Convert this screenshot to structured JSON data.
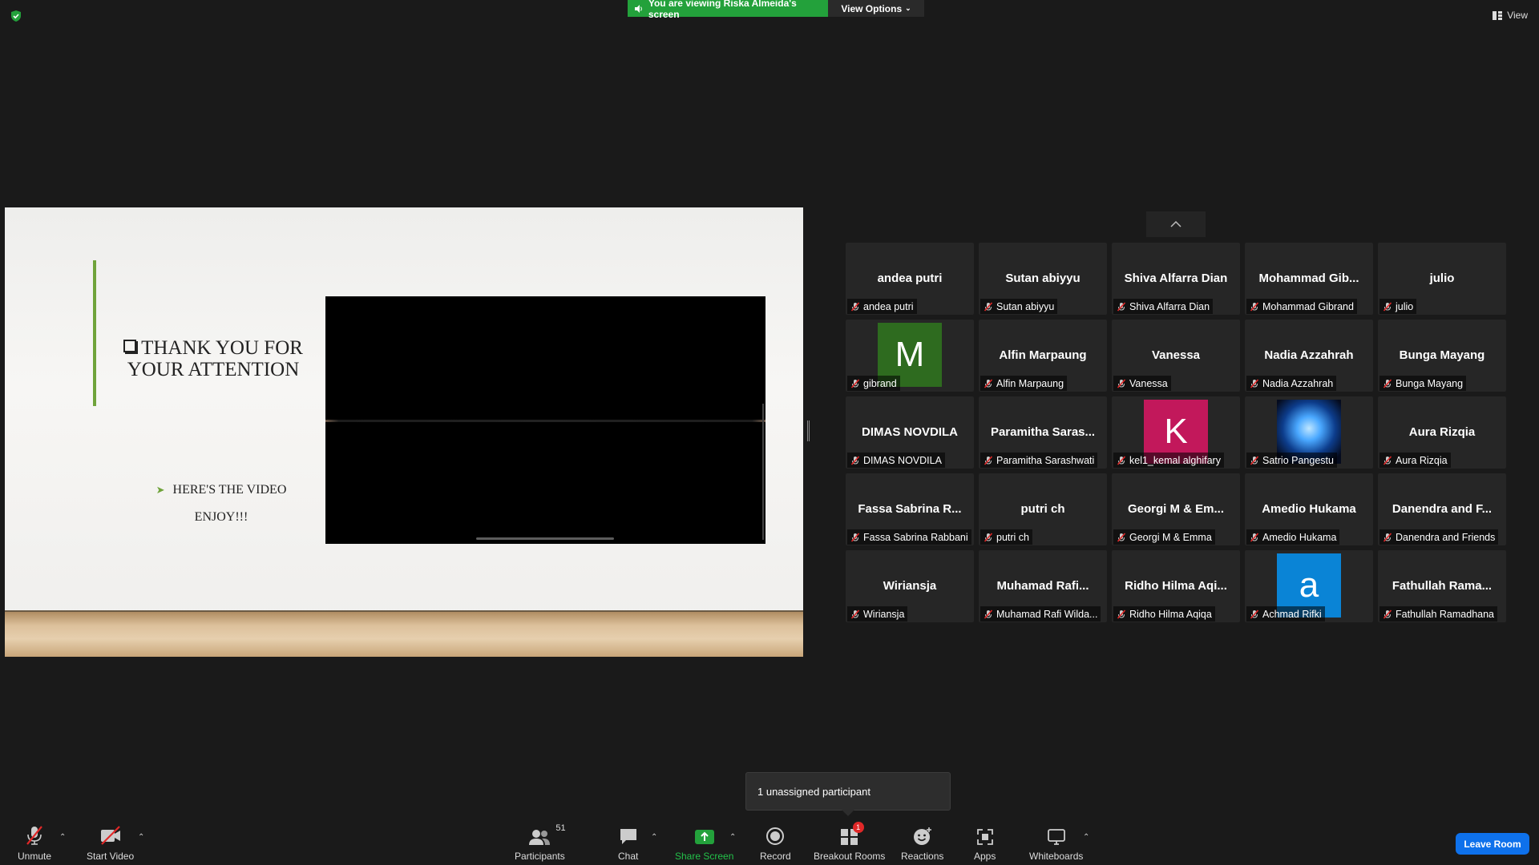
{
  "top_bar": {
    "viewing_banner": "You are viewing Riska Almeida's screen",
    "view_options": "View Options",
    "view": "View"
  },
  "slide": {
    "title": "THANK YOU FOR YOUR ATTENTION",
    "line1": "HERE'S THE VIDEO",
    "line2": "ENJOY!!!"
  },
  "gallery": {
    "tiles": [
      {
        "display": "andea putri",
        "label": "andea putri"
      },
      {
        "display": "Sutan abiyyu",
        "label": "Sutan abiyyu"
      },
      {
        "display": "Shiva Alfarra Dian",
        "label": "Shiva Alfarra Dian"
      },
      {
        "display": "Mohammad  Gib...",
        "label": "Mohammad Gibrand"
      },
      {
        "display": "julio",
        "label": "julio"
      },
      {
        "avatar": "M",
        "avatar_color": "#2e6b1f",
        "label": "gibrand"
      },
      {
        "display": "Alfin Marpaung",
        "label": "Alfin Marpaung"
      },
      {
        "display": "Vanessa",
        "label": "Vanessa"
      },
      {
        "display": "Nadia Azzahrah",
        "label": "Nadia Azzahrah"
      },
      {
        "display": "Bunga Mayang",
        "label": "Bunga Mayang"
      },
      {
        "display": "DIMAS NOVDILA",
        "label": "DIMAS NOVDILA"
      },
      {
        "display": "Paramitha  Saras...",
        "label": "Paramitha Sarashwati"
      },
      {
        "avatar": "K",
        "avatar_color": "#c2185b",
        "label": "kel1_kemal alghifary"
      },
      {
        "photo": "profile-photo",
        "label": "Satrio Pangestu"
      },
      {
        "display": "Aura Rizqia",
        "label": "Aura Rizqia"
      },
      {
        "display": "Fassa Sabrina  R...",
        "label": "Fassa Sabrina Rabbani"
      },
      {
        "display": "putri ch",
        "label": "putri ch"
      },
      {
        "display": "Georgi M & Em...",
        "label": "Georgi M & Emma"
      },
      {
        "display": "Amedio Hukama",
        "label": "Amedio Hukama"
      },
      {
        "display": "Danendra  and  F...",
        "label": "Danendra and Friends"
      },
      {
        "display": "Wiriansja",
        "label": "Wiriansja"
      },
      {
        "display": "Muhamad  Rafi...",
        "label": "Muhamad Rafi Wilda..."
      },
      {
        "display": "Ridho  Hilma  Aqi...",
        "label": "Ridho Hilma Aqiqa"
      },
      {
        "avatar": "a",
        "avatar_color": "#0a84d6",
        "label": "Achmad Rifki"
      },
      {
        "display": "Fathullah  Rama...",
        "label": "Fathullah Ramadhana"
      }
    ]
  },
  "toast": "1 unassigned participant",
  "toolbar": {
    "unmute": "Unmute",
    "start_video": "Start Video",
    "participants": "Participants",
    "participants_count": "51",
    "chat": "Chat",
    "share_screen": "Share Screen",
    "record": "Record",
    "breakout_rooms": "Breakout Rooms",
    "breakout_badge": "1",
    "reactions": "Reactions",
    "apps": "Apps",
    "whiteboards": "Whiteboards",
    "leave_room": "Leave Room"
  },
  "colors": {
    "banner_green": "#23a13b",
    "leave_blue": "#0e71eb",
    "slide_accent": "#6fa33a",
    "mic_off_red": "#e02828"
  }
}
